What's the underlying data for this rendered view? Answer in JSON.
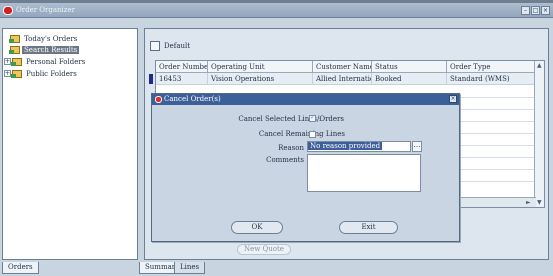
{
  "window": {
    "title": "Order Organizer",
    "buttons": [
      "–",
      "□",
      "×"
    ]
  },
  "left_panel": {
    "tree": [
      {
        "label": "Today's Orders",
        "state": "leaf"
      },
      {
        "label": "Search Results",
        "state": "selected"
      },
      {
        "label": "Personal Folders",
        "state": "collapsed"
      },
      {
        "label": "Public Folders",
        "state": "collapsed"
      }
    ],
    "tab": "Orders",
    "expander_symbol": "+"
  },
  "main_panel": {
    "default_label": "Default",
    "columns": [
      "Order Number",
      "Operating Unit",
      "Customer Name",
      "Status",
      "Order Type"
    ],
    "rows": [
      [
        "16453",
        "Vision Operations",
        "Allied International",
        "Booked",
        "Standard (WMS)"
      ]
    ],
    "faint_button": "New Quote",
    "tabs": [
      "Summary",
      "Lines"
    ]
  },
  "modal": {
    "title": "Cancel Order(s)",
    "close": "×",
    "cancel_selected_label": "Cancel Selected Lines/Orders",
    "cancel_remaining_label": "Cancel Remaining Lines",
    "suffix": ".",
    "reason_label": "Reason",
    "reason_value": "No reason provided",
    "reason_lov": "…",
    "comments_label": "Comments",
    "ok_label": "OK",
    "exit_label": "Exit"
  },
  "colors": {
    "accent": "#3d5f99",
    "brand": "#d42020"
  },
  "icons": [
    "app-icon",
    "folder-icon",
    "default-icon",
    "close-icon",
    "checkbox-icon"
  ]
}
